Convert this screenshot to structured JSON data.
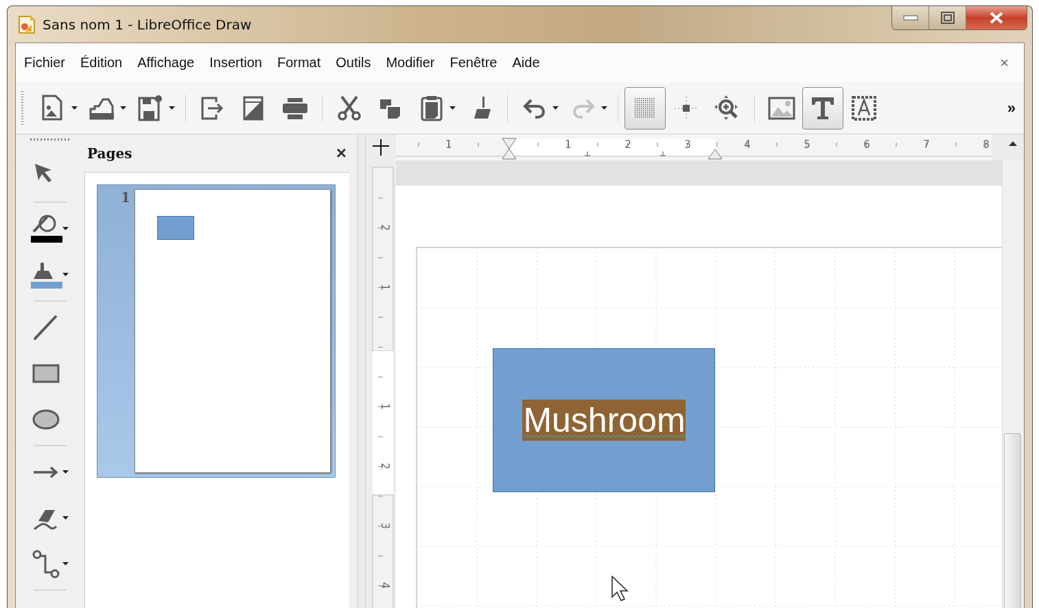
{
  "window": {
    "title": "Sans nom 1 - LibreOffice Draw"
  },
  "menu": [
    {
      "label": "Fichier"
    },
    {
      "label": "Édition"
    },
    {
      "label": "Affichage"
    },
    {
      "label": "Insertion"
    },
    {
      "label": "Format"
    },
    {
      "label": "Outils"
    },
    {
      "label": "Modifier"
    },
    {
      "label": "Fenêtre"
    },
    {
      "label": "Aide"
    }
  ],
  "document_close": "×",
  "toolbar": [
    {
      "kind": "new",
      "dropdown": true,
      "selected": false,
      "disabled": false
    },
    {
      "kind": "open",
      "dropdown": true,
      "selected": false,
      "disabled": false
    },
    {
      "kind": "save",
      "dropdown": true,
      "selected": false,
      "disabled": false
    },
    {
      "kind": "separator"
    },
    {
      "kind": "export",
      "dropdown": false,
      "selected": false,
      "disabled": false
    },
    {
      "kind": "pdf",
      "dropdown": false,
      "selected": false,
      "disabled": false
    },
    {
      "kind": "print",
      "dropdown": false,
      "selected": false,
      "disabled": false
    },
    {
      "kind": "separator"
    },
    {
      "kind": "cut",
      "dropdown": false,
      "selected": false,
      "disabled": false
    },
    {
      "kind": "copy",
      "dropdown": false,
      "selected": false,
      "disabled": false
    },
    {
      "kind": "paste",
      "dropdown": true,
      "selected": false,
      "disabled": false
    },
    {
      "kind": "brush",
      "dropdown": false,
      "selected": false,
      "disabled": false
    },
    {
      "kind": "separator"
    },
    {
      "kind": "undo",
      "dropdown": true,
      "selected": false,
      "disabled": false
    },
    {
      "kind": "redo",
      "dropdown": true,
      "selected": false,
      "disabled": true
    },
    {
      "kind": "separator"
    },
    {
      "kind": "grid",
      "dropdown": false,
      "selected": true,
      "disabled": false
    },
    {
      "kind": "helplines",
      "dropdown": false,
      "selected": false,
      "disabled": false
    },
    {
      "kind": "zoompan",
      "dropdown": false,
      "selected": false,
      "disabled": false
    },
    {
      "kind": "separator"
    },
    {
      "kind": "image",
      "dropdown": false,
      "selected": false,
      "disabled": false
    },
    {
      "kind": "text",
      "dropdown": false,
      "selected": true,
      "disabled": false
    },
    {
      "kind": "fontwork",
      "dropdown": false,
      "selected": false,
      "disabled": false
    }
  ],
  "toolbar_overflow": "»",
  "drawing_tools": [
    {
      "kind": "select",
      "dropdown": false
    },
    {
      "kind": "separator"
    },
    {
      "kind": "line-color",
      "dropdown": true,
      "color": "#000000"
    },
    {
      "kind": "fill-color",
      "dropdown": true,
      "color": "#729fcf"
    },
    {
      "kind": "separator"
    },
    {
      "kind": "line",
      "dropdown": false
    },
    {
      "kind": "rectangle",
      "dropdown": false
    },
    {
      "kind": "ellipse",
      "dropdown": false
    },
    {
      "kind": "separator"
    },
    {
      "kind": "arrow",
      "dropdown": true
    },
    {
      "kind": "curve",
      "dropdown": true
    },
    {
      "kind": "connector",
      "dropdown": true
    },
    {
      "kind": "separator"
    }
  ],
  "pages_panel": {
    "title": "Pages",
    "close": "×",
    "pages": [
      {
        "number": "1",
        "selected": true
      }
    ]
  },
  "ruler": {
    "horizontal": [
      "1",
      "1",
      "2",
      "3",
      "4",
      "5",
      "6",
      "7",
      "8"
    ],
    "vertical": [
      "2",
      "1",
      "1",
      "2",
      "3",
      "4"
    ]
  },
  "canvas": {
    "shape": {
      "text": "Mushroom",
      "text_selected": true
    }
  }
}
